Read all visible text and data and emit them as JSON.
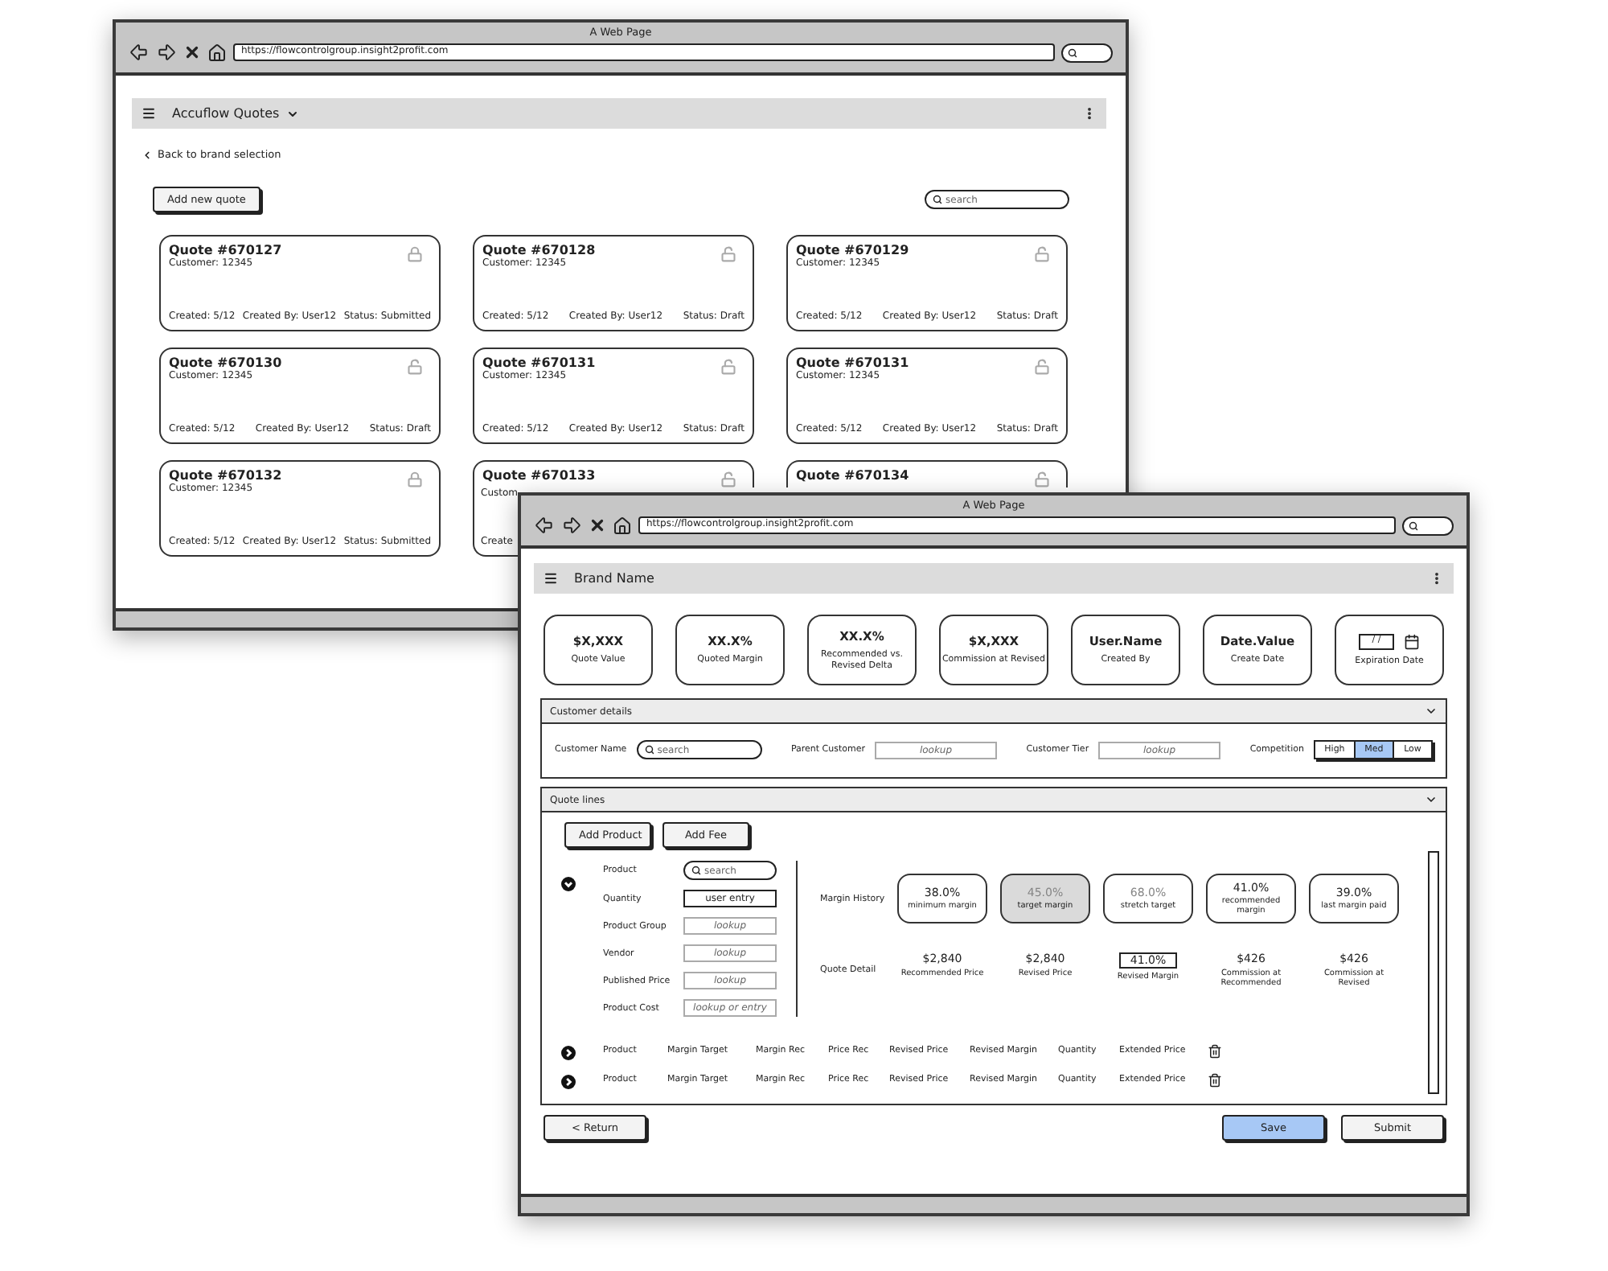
{
  "back_window": {
    "title": "A Web Page",
    "url": "https://flowcontrolgroup.insight2profit.com",
    "app_title": "Accuflow Quotes",
    "back_link": "Back to brand selection",
    "add_button": "Add new quote",
    "search": {
      "placeholder": "search"
    },
    "quotes": [
      {
        "title": "Quote #670127",
        "customer": "Customer: 12345",
        "created": "Created: 5/12",
        "created_by": "Created By: User12",
        "status": "Status: Submitted",
        "locked": true
      },
      {
        "title": "Quote #670128",
        "customer": "Customer: 12345",
        "created": "Created: 5/12",
        "created_by": "Created By: User12",
        "status": "Status: Draft",
        "locked": false
      },
      {
        "title": "Quote #670129",
        "customer": "Customer: 12345",
        "created": "Created: 5/12",
        "created_by": "Created By: User12",
        "status": "Status: Draft",
        "locked": false
      },
      {
        "title": "Quote #670130",
        "customer": "Customer: 12345",
        "created": "Created: 5/12",
        "created_by": "Created By: User12",
        "status": "Status: Draft",
        "locked": false
      },
      {
        "title": "Quote #670131",
        "customer": "Customer: 12345",
        "created": "Created: 5/12",
        "created_by": "Created By: User12",
        "status": "Status: Draft",
        "locked": false
      },
      {
        "title": "Quote #670131",
        "customer": "Customer: 12345",
        "created": "Created: 5/12",
        "created_by": "Created By: User12",
        "status": "Status: Draft",
        "locked": false
      },
      {
        "title": "Quote #670132",
        "customer": "Customer: 12345",
        "created": "Created: 5/12",
        "created_by": "Created By: User12",
        "status": "Status: Submitted",
        "locked": true
      },
      {
        "title": "Quote #670133",
        "customer": "Custom",
        "created": "Create",
        "locked": false
      },
      {
        "title": "Quote #670134",
        "locked": false
      }
    ]
  },
  "front_window": {
    "title": "A Web Page",
    "url": "https://flowcontrolgroup.insight2profit.com",
    "app_title": "Brand Name",
    "summary": [
      {
        "kind": "stat",
        "value": "$X,XXX",
        "label": "Quote Value"
      },
      {
        "kind": "stat",
        "value": "XX.X%",
        "label": "Quoted Margin"
      },
      {
        "kind": "stat",
        "value": "XX.X%",
        "label": "Recommended vs. Revised Delta"
      },
      {
        "kind": "stat",
        "value": "$X,XXX",
        "label": "Commission at Revised"
      },
      {
        "kind": "stat",
        "value": "User.Name",
        "label": "Created By"
      },
      {
        "kind": "stat",
        "value": "Date.Value",
        "label": "Create Date"
      },
      {
        "kind": "date",
        "value": "/ /",
        "label": "Expiration Date"
      }
    ],
    "customer_details": {
      "title": "Customer details",
      "customer_name": {
        "label": "Customer Name",
        "placeholder": "search"
      },
      "parent_customer": {
        "label": "Parent Customer",
        "placeholder": "lookup"
      },
      "customer_tier": {
        "label": "Customer Tier",
        "placeholder": "lookup"
      },
      "competition": {
        "label": "Competition",
        "options": [
          {
            "label": "High",
            "selected": false
          },
          {
            "label": "Med",
            "selected": true
          },
          {
            "label": "Low",
            "selected": false
          }
        ]
      }
    },
    "quote_lines": {
      "title": "Quote lines",
      "buttons": [
        "Add Product",
        "Add Fee"
      ],
      "product": {
        "expanded": true,
        "fields": [
          {
            "kind": "search",
            "label": "Product",
            "placeholder": "search"
          },
          {
            "kind": "entry",
            "label": "Quantity",
            "value": "user entry"
          },
          {
            "kind": "lookup",
            "label": "Product Group",
            "placeholder": "lookup"
          },
          {
            "kind": "lookup",
            "label": "Vendor",
            "placeholder": "lookup"
          },
          {
            "kind": "lookup",
            "label": "Published Price",
            "placeholder": "lookup"
          },
          {
            "kind": "lookup",
            "label": "Product Cost",
            "placeholder": "lookup or entry"
          }
        ]
      },
      "margin_history": {
        "label": "Margin History",
        "items": [
          {
            "value": "38.0%",
            "label": "minimum margin",
            "selected": false,
            "dimmed": false
          },
          {
            "value": "45.0%",
            "label": "target margin",
            "selected": true,
            "dimmed": true
          },
          {
            "value": "68.0%",
            "label": "stretch target",
            "selected": false,
            "dimmed": true
          },
          {
            "value": "41.0%",
            "label": "recommended margin",
            "selected": false,
            "dimmed": false
          },
          {
            "value": "39.0%",
            "label": "last margin paid",
            "selected": false,
            "dimmed": false
          }
        ]
      },
      "quote_detail": {
        "label": "Quote Detail",
        "items": [
          {
            "kind": "text",
            "value": "$2,840",
            "label": "Recommended Price"
          },
          {
            "kind": "text",
            "value": "$2,840",
            "label": "Revised Price"
          },
          {
            "kind": "field",
            "value": "41.0%",
            "label": "Revised Margin"
          },
          {
            "kind": "text",
            "value": "$426",
            "label": "Commission at Recommended"
          },
          {
            "kind": "text",
            "value": "$426",
            "label": "Commission at Revised"
          }
        ]
      },
      "lines": [
        {
          "expanded": false,
          "cells": [
            "Product",
            "Margin Target",
            "Margin Rec",
            "Price Rec",
            "Revised Price",
            "Revised Margin",
            "Quantity",
            "Extended Price"
          ]
        },
        {
          "expanded": false,
          "cells": [
            "Product",
            "Margin Target",
            "Margin Rec",
            "Price Rec",
            "Revised Price",
            "Revised Margin",
            "Quantity",
            "Extended Price"
          ]
        }
      ]
    },
    "buttons": [
      {
        "label": "< Return",
        "primary": false
      },
      {
        "label": "Save",
        "primary": true
      },
      {
        "label": "Submit",
        "primary": false
      }
    ]
  }
}
